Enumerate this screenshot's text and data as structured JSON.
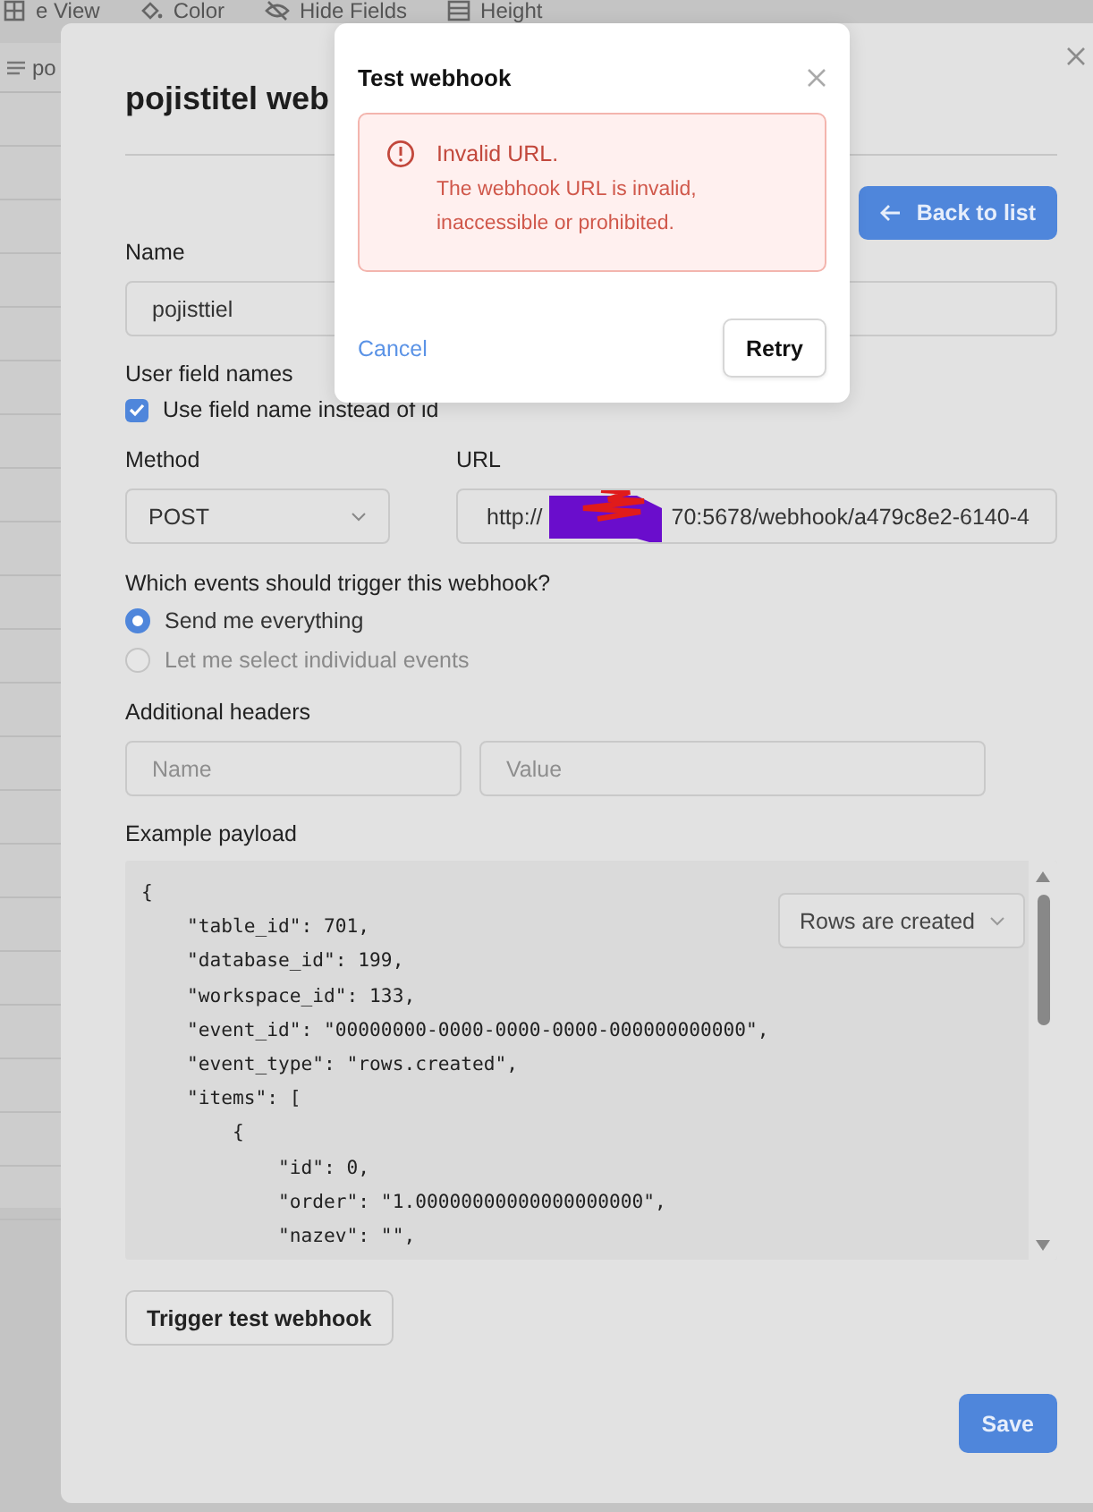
{
  "background_app": {
    "toolbar": [
      {
        "label": "e View"
      },
      {
        "label": "Color"
      },
      {
        "label": "Hide Fields"
      },
      {
        "label": "Height"
      }
    ],
    "grid_header": "po"
  },
  "modal": {
    "title": "pojistitel web",
    "back_button": "Back to list",
    "name_field": {
      "label": "Name",
      "value": "pojisttiel"
    },
    "user_field_names": {
      "label": "User field names",
      "option": "Use field name instead of id",
      "checked": true
    },
    "method": {
      "label": "Method",
      "value": "POST"
    },
    "url": {
      "label": "URL",
      "value_start": "http://",
      "value_end": "70:5678/webhook/a479c8e2-6140-4"
    },
    "events": {
      "label": "Which events should trigger this webhook?",
      "options": [
        {
          "label": "Send me everything",
          "selected": true
        },
        {
          "label": "Let me select individual events",
          "selected": false
        }
      ]
    },
    "headers": {
      "label": "Additional headers",
      "name_placeholder": "Name",
      "value_placeholder": "Value"
    },
    "payload": {
      "label": "Example payload",
      "event_select": "Rows are created",
      "lines": [
        "{",
        "    \"table_id\": 701,",
        "    \"database_id\": 199,",
        "    \"workspace_id\": 133,",
        "    \"event_id\": \"00000000-0000-0000-0000-000000000000\",",
        "    \"event_type\": \"rows.created\",",
        "    \"items\": [",
        "        {",
        "            \"id\": 0,",
        "            \"order\": \"1.00000000000000000000\",",
        "            \"nazev\": \"\","
      ]
    },
    "trigger_button": "Trigger test webhook",
    "save_button": "Save"
  },
  "dialog": {
    "title": "Test webhook",
    "error_title": "Invalid URL.",
    "error_message": "The webhook URL is invalid, inaccessible or prohibited.",
    "cancel": "Cancel",
    "retry": "Retry"
  }
}
